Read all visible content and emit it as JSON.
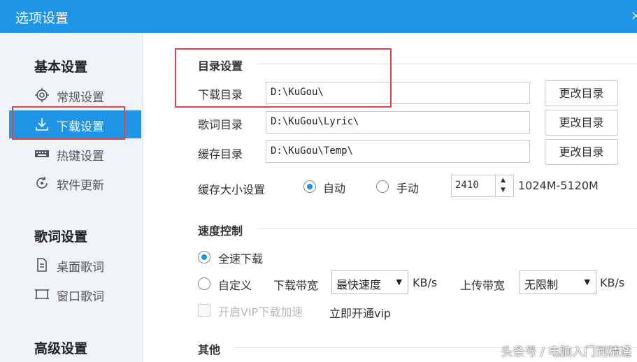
{
  "window": {
    "title": "选项设置",
    "close_glyph": "×"
  },
  "sidebar": {
    "groups": [
      {
        "title": "基本设置",
        "items": [
          {
            "label": "常规设置",
            "icon": "gear-icon"
          },
          {
            "label": "下载设置",
            "icon": "download-icon",
            "active": true
          },
          {
            "label": "热键设置",
            "icon": "keyboard-icon"
          },
          {
            "label": "软件更新",
            "icon": "refresh-icon"
          }
        ]
      },
      {
        "title": "歌词设置",
        "items": [
          {
            "label": "桌面歌词",
            "icon": "desktop-lyric-icon"
          },
          {
            "label": "窗口歌词",
            "icon": "window-lyric-icon"
          }
        ]
      },
      {
        "title": "高级设置",
        "items": []
      }
    ]
  },
  "directory": {
    "section_title": "目录设置",
    "rows": [
      {
        "label": "下载目录",
        "value": "D:\\KuGou\\",
        "button": "更改目录"
      },
      {
        "label": "歌词目录",
        "value": "D:\\KuGou\\Lyric\\",
        "button": "更改目录"
      },
      {
        "label": "缓存目录",
        "value": "D:\\KuGou\\Temp\\",
        "button": "更改目录"
      }
    ],
    "cache": {
      "label": "缓存大小设置",
      "auto": "自动",
      "manual": "手动",
      "selected": "auto",
      "value": "2410",
      "range": "1024M-5120M"
    }
  },
  "speed": {
    "section_title": "速度控制",
    "full_speed": "全速下载",
    "custom": "自定义",
    "selected": "full_speed",
    "download_bandwidth_label": "下载带宽",
    "download_bandwidth_value": "最快速度",
    "upload_bandwidth_label": "上传带宽",
    "upload_bandwidth_value": "无限制",
    "unit": "KB/s",
    "vip_checkbox": "开启VIP下载加速",
    "vip_link": "立即开通vip"
  },
  "other": {
    "section_title": "其他"
  },
  "watermark": "头条号 / 电脑入门到精通",
  "colors": {
    "accent": "#1e95e6",
    "highlight_box": "#e04545"
  }
}
